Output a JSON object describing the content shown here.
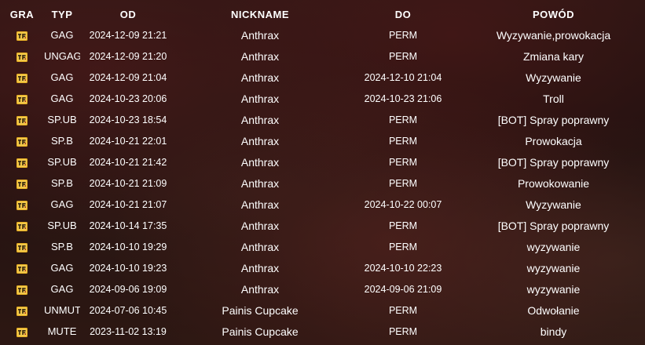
{
  "headers": {
    "game": "GRA",
    "type": "TYP",
    "from": "OD",
    "nickname": "NICKNAME",
    "to": "DO",
    "reason": "POWÓD"
  },
  "game_icon": "tf2-game-icon",
  "colors": {
    "icon": "#e8b024",
    "text": "#ffffff"
  },
  "rows": [
    {
      "type": "GAG",
      "from": "2024-12-09 21:21",
      "nickname": "Anthrax",
      "to": "PERM",
      "reason": "Wyzywanie,prowokacja"
    },
    {
      "type": "UNGAG",
      "from": "2024-12-09 21:20",
      "nickname": "Anthrax",
      "to": "PERM",
      "reason": "Zmiana kary"
    },
    {
      "type": "GAG",
      "from": "2024-12-09 21:04",
      "nickname": "Anthrax",
      "to": "2024-12-10 21:04",
      "reason": "Wyzywanie"
    },
    {
      "type": "GAG",
      "from": "2024-10-23 20:06",
      "nickname": "Anthrax",
      "to": "2024-10-23 21:06",
      "reason": "Troll"
    },
    {
      "type": "SP.UB",
      "from": "2024-10-23 18:54",
      "nickname": "Anthrax",
      "to": "PERM",
      "reason": "[BOT] Spray poprawny"
    },
    {
      "type": "SP.B",
      "from": "2024-10-21 22:01",
      "nickname": "Anthrax",
      "to": "PERM",
      "reason": "Prowokacja"
    },
    {
      "type": "SP.UB",
      "from": "2024-10-21 21:42",
      "nickname": "Anthrax",
      "to": "PERM",
      "reason": "[BOT] Spray poprawny"
    },
    {
      "type": "SP.B",
      "from": "2024-10-21 21:09",
      "nickname": "Anthrax",
      "to": "PERM",
      "reason": "Prowokowanie"
    },
    {
      "type": "GAG",
      "from": "2024-10-21 21:07",
      "nickname": "Anthrax",
      "to": "2024-10-22 00:07",
      "reason": "Wyzywanie"
    },
    {
      "type": "SP.UB",
      "from": "2024-10-14 17:35",
      "nickname": "Anthrax",
      "to": "PERM",
      "reason": "[BOT] Spray poprawny"
    },
    {
      "type": "SP.B",
      "from": "2024-10-10 19:29",
      "nickname": "Anthrax",
      "to": "PERM",
      "reason": "wyzywanie"
    },
    {
      "type": "GAG",
      "from": "2024-10-10 19:23",
      "nickname": "Anthrax",
      "to": "2024-10-10 22:23",
      "reason": "wyzywanie"
    },
    {
      "type": "GAG",
      "from": "2024-09-06 19:09",
      "nickname": "Anthrax",
      "to": "2024-09-06 21:09",
      "reason": "wyzywanie"
    },
    {
      "type": "UNMUTE",
      "from": "2024-07-06 10:45",
      "nickname": "Painis Cupcake",
      "to": "PERM",
      "reason": "Odwołanie"
    },
    {
      "type": "MUTE",
      "from": "2023-11-02 13:19",
      "nickname": "Painis Cupcake",
      "to": "PERM",
      "reason": "bindy"
    }
  ]
}
